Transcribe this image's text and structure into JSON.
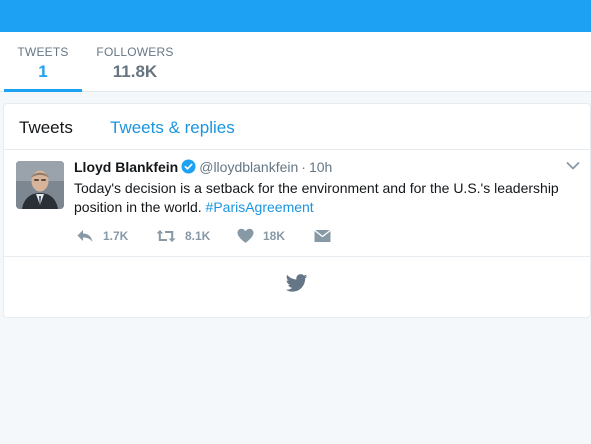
{
  "colors": {
    "brand": "#1da1f2",
    "link": "#1b95e0",
    "muted": "#657786",
    "action": "#8899a6"
  },
  "stats": [
    {
      "label": "TWEETS",
      "value": "1"
    },
    {
      "label": "FOLLOWERS",
      "value": "11.8K"
    }
  ],
  "tabs": {
    "tweets": "Tweets",
    "replies": "Tweets & replies"
  },
  "tweet": {
    "name": "Lloyd Blankfein",
    "handle": "@lloydblankfein",
    "separator": "·",
    "time": "10h",
    "text": "Today's decision is a setback for the environment and for the U.S.'s leadership position in the world. ",
    "hashtag": "#ParisAgreement",
    "reply_icon": "reply-icon",
    "retweets": "1.7K",
    "likes_label": "8.1K",
    "hearts": "18K"
  },
  "icons": [
    "verified-icon",
    "chevron-down-icon",
    "reply-icon",
    "retweet-icon",
    "heart-icon",
    "envelope-icon",
    "twitter-bird-icon"
  ]
}
